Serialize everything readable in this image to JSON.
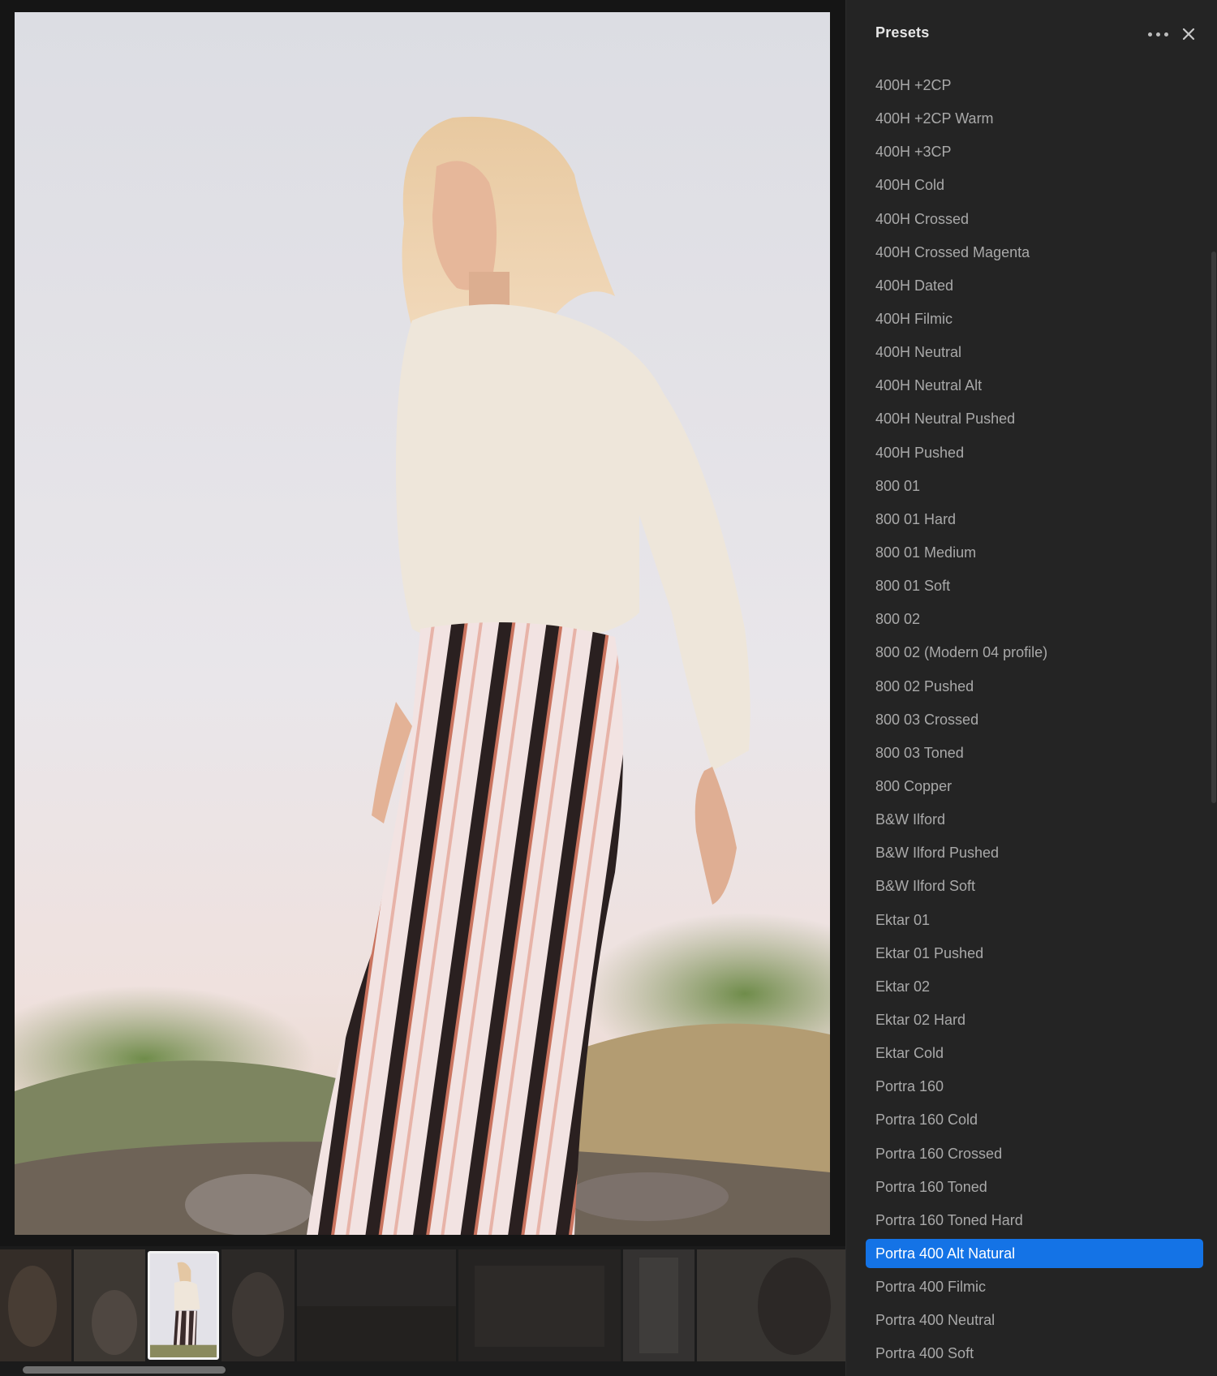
{
  "panel": {
    "title": "Presets",
    "more_icon": "more-horizontal-icon",
    "close_icon": "close-icon",
    "selected_index": 35,
    "presets": [
      "400H +2CP",
      "400H +2CP Warm",
      "400H +3CP",
      "400H Cold",
      "400H Crossed",
      "400H Crossed Magenta",
      "400H Dated",
      "400H Filmic",
      "400H Neutral",
      "400H Neutral Alt",
      "400H Neutral Pushed",
      "400H Pushed",
      "800 01",
      "800 01 Hard",
      "800 01 Medium",
      "800 01 Soft",
      "800 02",
      "800 02 (Modern 04 profile)",
      "800 02 Pushed",
      "800 03 Crossed",
      "800 03 Toned",
      "800 Copper",
      "B&W Ilford",
      "B&W Ilford Pushed",
      "B&W Ilford Soft",
      "Ektar 01",
      "Ektar 01 Pushed",
      "Ektar 02",
      "Ektar 02 Hard",
      "Ektar Cold",
      "Portra 160",
      "Portra 160 Cold",
      "Portra 160 Crossed",
      "Portra 160 Toned",
      "Portra 160 Toned Hard",
      "Portra 400 Alt Natural",
      "Portra 400 Filmic",
      "Portra 400 Neutral",
      "Portra 400 Soft"
    ]
  },
  "colors": {
    "accent": "#1473e6",
    "panel_bg": "#242424",
    "text": "#a9a9a9"
  },
  "filmstrip": {
    "selected_thumb": 2
  }
}
